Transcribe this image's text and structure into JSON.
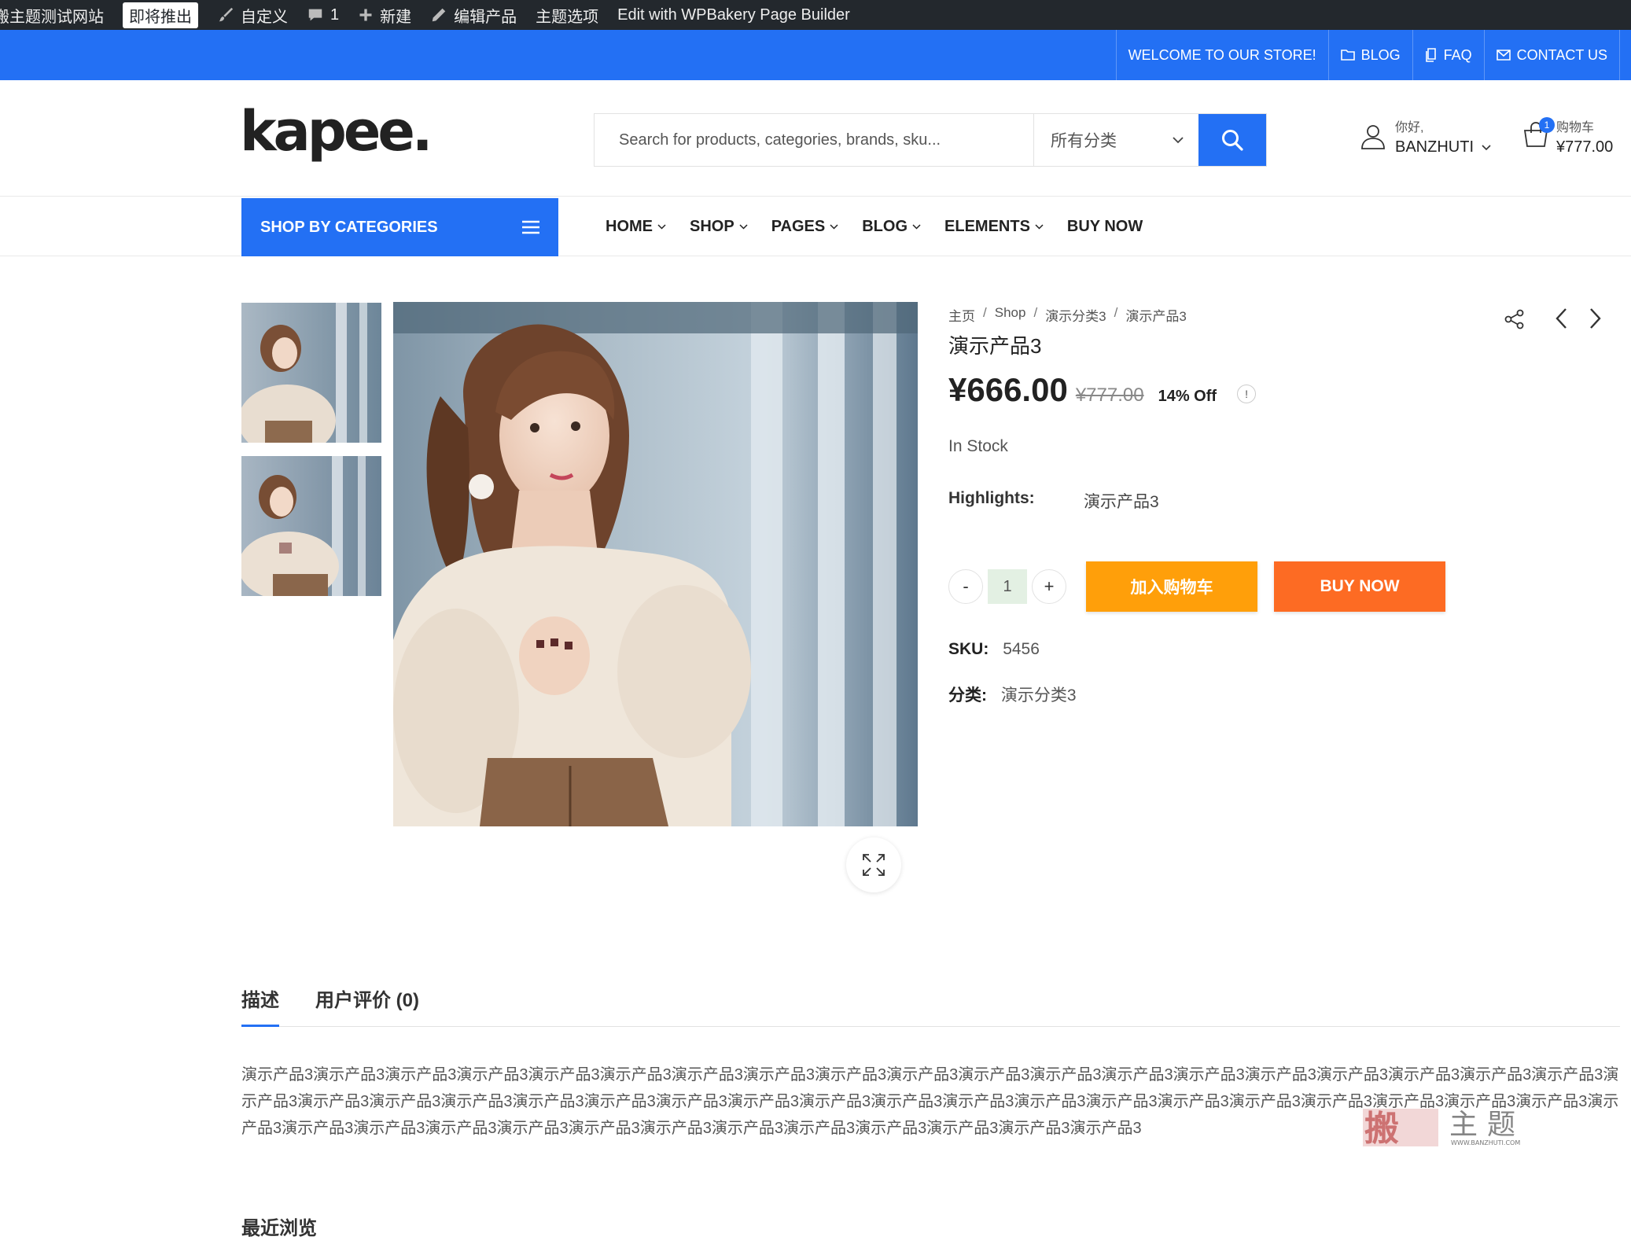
{
  "admin_bar": {
    "site_name": "搬主题测试网站",
    "launch_badge": "即将推出",
    "customize": "自定义",
    "comments_count": "1",
    "new": "新建",
    "edit_product": "编辑产品",
    "theme_options": "主题选项",
    "wpbakery": "Edit with WPBakery Page Builder"
  },
  "top_bar": {
    "welcome": "WELCOME TO OUR STORE!",
    "blog": "BLOG",
    "faq": "FAQ",
    "contact": "CONTACT US"
  },
  "header": {
    "logo": "kapee.",
    "search_placeholder": "Search for products, categories, brands, sku...",
    "category_select": "所有分类",
    "user_greeting": "你好,",
    "user_name": "BANZHUTI",
    "cart_label": "购物车",
    "cart_count": "1",
    "cart_total": "¥777.00"
  },
  "nav": {
    "shop_by_categories": "SHOP BY CATEGORIES",
    "items": [
      {
        "label": "HOME",
        "dropdown": true
      },
      {
        "label": "SHOP",
        "dropdown": true
      },
      {
        "label": "PAGES",
        "dropdown": true
      },
      {
        "label": "BLOG",
        "dropdown": true
      },
      {
        "label": "ELEMENTS",
        "dropdown": true
      },
      {
        "label": "BUY NOW",
        "dropdown": false
      }
    ]
  },
  "product": {
    "breadcrumb": [
      "主页",
      "Shop",
      "演示分类3",
      "演示产品3"
    ],
    "title": "演示产品3",
    "price": "¥666.00",
    "old_price": "¥777.00",
    "discount": "14% Off",
    "info": "!",
    "stock": "In Stock",
    "highlights_label": "Highlights:",
    "highlights_value": "演示产品3",
    "qty_minus": "-",
    "qty_value": "1",
    "qty_plus": "+",
    "add_to_cart": "加入购物车",
    "buy_now": "BUY NOW",
    "sku_label": "SKU:",
    "sku_value": "5456",
    "category_label": "分类:",
    "category_value": "演示分类3"
  },
  "tabs": {
    "description": "描述",
    "reviews": "用户评价 (0)"
  },
  "description_text": "演示产品3演示产品3演示产品3演示产品3演示产品3演示产品3演示产品3演示产品3演示产品3演示产品3演示产品3演示产品3演示产品3演示产品3演示产品3演示产品3演示产品3演示产品3演示产品3演示产品3演示产品3演示产品3演示产品3演示产品3演示产品3演示产品3演示产品3演示产品3演示产品3演示产品3演示产品3演示产品3演示产品3演示产品3演示产品3演示产品3演示产品3演示产品3演示产品3演示产品3演示产品3演示产品3演示产品3演示产品3演示产品3演示产品3演示产品3演示产品3演示产品3演示产品3演示产品3",
  "recently_viewed": "最近浏览",
  "watermark": {
    "text": "搬主题",
    "url": "WWW.BANZHUTI.COM"
  },
  "colors": {
    "primary": "#2370f4",
    "add_to_cart": "#ff9f0a",
    "buy_now": "#fd6b23",
    "admin_bar": "#23282d"
  }
}
